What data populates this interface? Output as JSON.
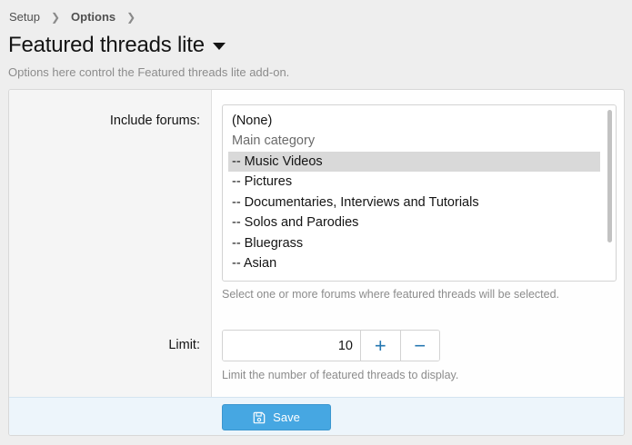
{
  "breadcrumb": {
    "items": [
      "Setup",
      "Options"
    ]
  },
  "page": {
    "title": "Featured threads lite",
    "description": "Options here control the Featured threads lite add-on."
  },
  "include_forums": {
    "label": "Include forums:",
    "options": [
      {
        "text": "(None)",
        "type": "option",
        "selected": false
      },
      {
        "text": "Main category",
        "type": "group",
        "selected": false
      },
      {
        "text": "-- Music Videos",
        "type": "option",
        "selected": true
      },
      {
        "text": "-- Pictures",
        "type": "option",
        "selected": false
      },
      {
        "text": "-- Documentaries, Interviews and Tutorials",
        "type": "option",
        "selected": false
      },
      {
        "text": "-- Solos and Parodies",
        "type": "option",
        "selected": false
      },
      {
        "text": "-- Bluegrass",
        "type": "option",
        "selected": false
      },
      {
        "text": "-- Asian",
        "type": "option",
        "selected": false
      }
    ],
    "explain": "Select one or more forums where featured threads will be selected."
  },
  "limit": {
    "label": "Limit:",
    "value": "10",
    "increment_symbol": "+",
    "decrement_symbol": "−",
    "explain": "Limit the number of featured threads to display."
  },
  "footer": {
    "save_label": "Save"
  },
  "icons": {
    "breadcrumb_separator": "chevron-right-icon",
    "title_menu": "caret-down-icon",
    "save": "floppy-disk-icon"
  },
  "colors": {
    "accent": "#2577b1",
    "button_bg": "#46a7e2",
    "footer_bg": "#edf5fb",
    "selected_option_bg": "#d9d9d9"
  }
}
